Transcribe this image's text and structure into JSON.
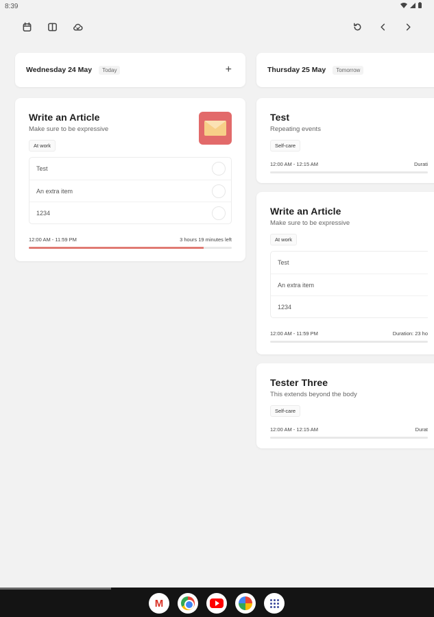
{
  "status_bar": {
    "time": "8:39"
  },
  "toolbar": {
    "left_icons": [
      "calendar-icon",
      "columns-icon",
      "cloud-sync-icon"
    ],
    "right_icons": [
      "refresh-icon",
      "chevron-left-icon",
      "chevron-right-icon"
    ]
  },
  "days": [
    {
      "date": "Wednesday 24 May",
      "relative": "Today",
      "add_label": "+"
    },
    {
      "date": "Thursday 25 May",
      "relative": "Tomorrow"
    }
  ],
  "events_today": [
    {
      "title": "Write an Article",
      "description": "Make sure to be expressive",
      "tag": "At work",
      "thumbnail_icon": "envelope-icon",
      "checklist": [
        "Test",
        "An extra item",
        "1234"
      ],
      "time_range": "12:00 AM - 11:59 PM",
      "remaining": "3 hours 19 minutes left",
      "progress": 0.86
    }
  ],
  "events_tomorrow": [
    {
      "title": "Test",
      "description": "Repeating events",
      "tag": "Self-care",
      "time_range": "12:00 AM - 12:15 AM",
      "duration": "Durati"
    },
    {
      "title": "Write an Article",
      "description": "Make sure to be expressive",
      "tag": "At work",
      "checklist": [
        "Test",
        "An extra item",
        "1234"
      ],
      "time_range": "12:00 AM - 11:59 PM",
      "duration": "Duration: 23 ho"
    },
    {
      "title": "Tester Three",
      "description": "This extends beyond the body",
      "tag": "Self-care",
      "time_range": "12:00 AM - 12:15 AM",
      "duration": "Durat"
    }
  ],
  "dock": {
    "apps": [
      "gmail-icon",
      "chrome-icon",
      "youtube-icon",
      "photos-icon",
      "app-drawer-icon"
    ]
  },
  "colors": {
    "background": "#f2f2f2",
    "card": "#ffffff",
    "progress": "#e07a73",
    "thumbnail": "#e26a6a",
    "nav": "#141414"
  }
}
